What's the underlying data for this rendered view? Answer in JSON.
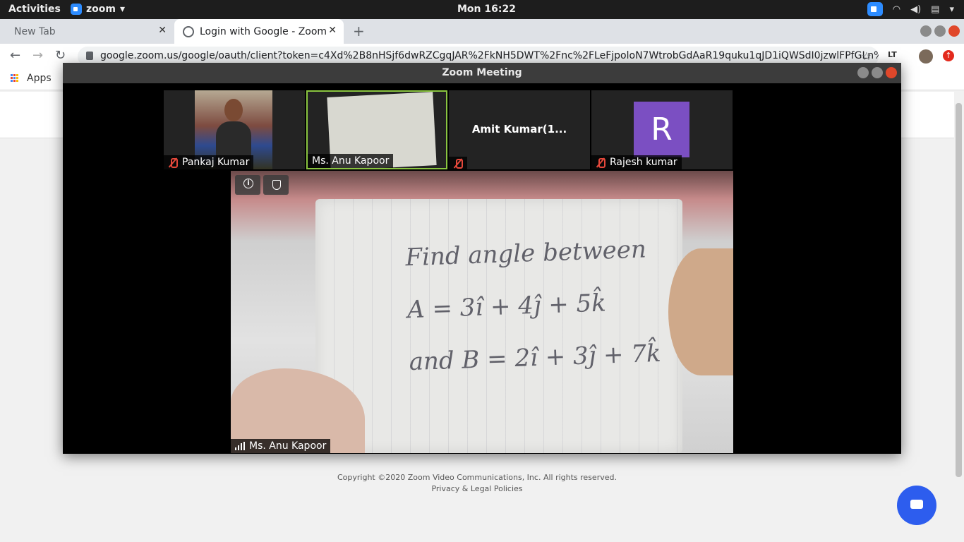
{
  "topbar": {
    "activities": "Activities",
    "app_name": "zoom",
    "clock": "Mon 16:22"
  },
  "browser": {
    "tabs": [
      {
        "label": "New Tab",
        "active": false
      },
      {
        "label": "Login with Google - Zoom",
        "active": true
      }
    ],
    "url": "google.zoom.us/google/oauth/client?token=c4Xd%2B8nHSjf6dwRZCgqJAR%2FkNH5DWT%2Fnc%2FLeFjpoloN7WtrobGdAaR19quku1qJD1iQWSdI0jzwlFPfGLn%2FL...",
    "bookmarks": [
      {
        "label": "Apps"
      }
    ],
    "ext_label": "LT"
  },
  "zoom": {
    "title": "Zoom Meeting",
    "participants": [
      {
        "name": "Pankaj Kumar",
        "muted": true
      },
      {
        "name": "Ms. Anu Kapoor",
        "muted": false
      },
      {
        "name": "Amit Kumar(1...",
        "muted": true
      },
      {
        "name": "Rajesh kumar",
        "muted": true,
        "initial": "R"
      }
    ],
    "main_speaker": "Ms. Anu Kapoor",
    "whiteboard_lines": [
      "Find angle between",
      "A = 3î + 4ĵ + 5k̂",
      "and B = 2î + 3ĵ + 7k̂"
    ]
  },
  "footer": {
    "copyright": "Copyright ©2020 Zoom Video Communications, Inc. All rights reserved.",
    "privacy": "Privacy & Legal Policies"
  },
  "colors": {
    "zoom_blue": "#2d8cff",
    "active_speaker_border": "#8ac540",
    "avatar_purple": "#7b4fc2",
    "muted_red": "#e5483b",
    "chat_button": "#2d5dee"
  }
}
